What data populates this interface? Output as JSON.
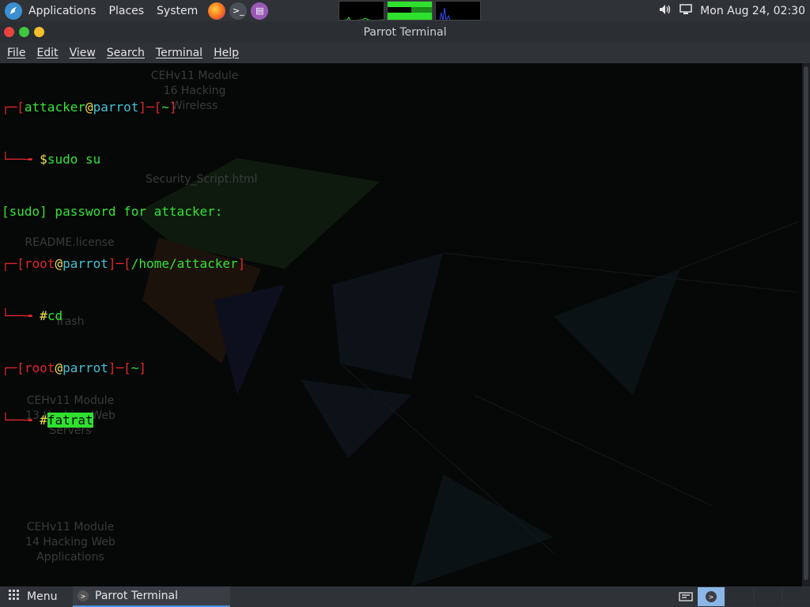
{
  "top_panel": {
    "applications": "Applications",
    "places": "Places",
    "system": "System",
    "datetime": "Mon Aug 24, 02:30",
    "launchers": [
      "firefox-icon",
      "terminal-icon",
      "text-editor-icon"
    ]
  },
  "window": {
    "title": "Parrot Terminal"
  },
  "menubar": {
    "items": [
      "File",
      "Edit",
      "View",
      "Search",
      "Terminal",
      "Help"
    ]
  },
  "terminal": {
    "line1_user": "attacker",
    "line1_at": "@",
    "line1_host": "parrot",
    "line1_dir": "~",
    "line2_prompt": "$",
    "line2_cmd": "sudo su",
    "line3": "[sudo] password for attacker:",
    "line4_user": "root",
    "line4_at": "@",
    "line4_host": "parrot",
    "line4_dir": "/home/attacker",
    "line5_prompt": "#",
    "line5_cmd": "cd",
    "line6_user": "root",
    "line6_at": "@",
    "line6_host": "parrot",
    "line6_dir": "~",
    "line7_prompt": "#",
    "line7_cmd": "fatrat"
  },
  "desktop_icons": [
    "CEHv11 Module 16 Hacking Wireless",
    "Security_Script.html",
    "README.license",
    "Trash",
    "CEHv11 Module 13 Hacking Web Servers",
    "CEHv11 Module 14 Hacking Web Applications"
  ],
  "bottom_panel": {
    "menu": "Menu",
    "task": "Parrot Terminal"
  },
  "colors": {
    "prompt_red": "#e0282a",
    "command_green": "#35e335",
    "host_cyan": "#44c2d4"
  }
}
